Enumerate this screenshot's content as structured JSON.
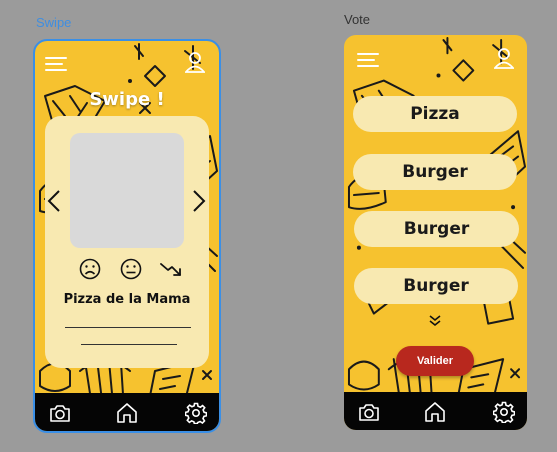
{
  "colors": {
    "background": "#9b9b9b",
    "accent_yellow": "#f6c22f",
    "card_cream": "#f8e9b1",
    "bar_black": "#050505",
    "validate_red": "#b8281e",
    "selection_blue": "#3a8fe6"
  },
  "frames": {
    "swipe_label": "Swipe",
    "vote_label": "Vote"
  },
  "swipe": {
    "title": "Swipe !",
    "dish_name": "Pizza de la Mama",
    "icons": [
      "menu-icon",
      "user-icon",
      "chevron-left-icon",
      "chevron-right-icon",
      "sad-face-icon",
      "neutral-face-icon",
      "trend-down-icon"
    ]
  },
  "vote": {
    "options": [
      "Pizza",
      "Burger",
      "Burger",
      "Burger"
    ],
    "validate_label": "Valider",
    "icons": [
      "menu-icon",
      "user-icon",
      "double-chevron-down-icon"
    ]
  },
  "nav": {
    "icons": [
      "camera-icon",
      "home-icon",
      "gear-icon"
    ]
  }
}
